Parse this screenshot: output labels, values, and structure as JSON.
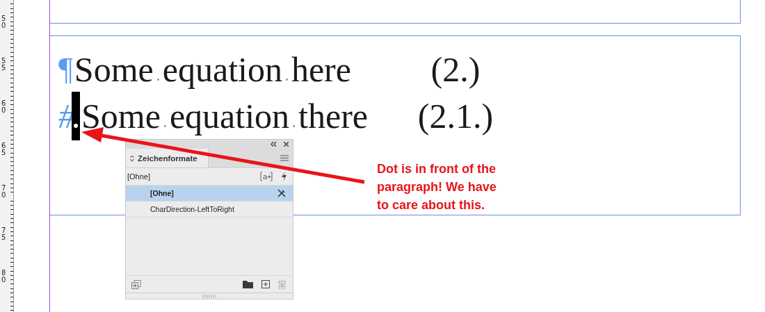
{
  "ruler": {
    "labels": [
      "50",
      "55",
      "60",
      "65",
      "70",
      "75",
      "80"
    ]
  },
  "document": {
    "lines": [
      {
        "kind": "pilcrow",
        "marker": "¶",
        "text": "Some equation here",
        "number": "(2.)",
        "selection": false
      },
      {
        "kind": "hash",
        "marker": "#",
        "text": "Some equation there",
        "number": "(2.1.)",
        "selection": true
      }
    ]
  },
  "panel": {
    "title": "Zeichenformate",
    "current": "[Ohne]",
    "new_style_button": "a+",
    "styles": [
      {
        "name": "[Ohne]",
        "selected": true,
        "locked": true
      },
      {
        "name": "CharDirection-LeftToRight",
        "selected": false,
        "locked": false
      }
    ]
  },
  "note": {
    "text": "Dot is in front of the\nparagraph! We have\nto care about this."
  }
}
